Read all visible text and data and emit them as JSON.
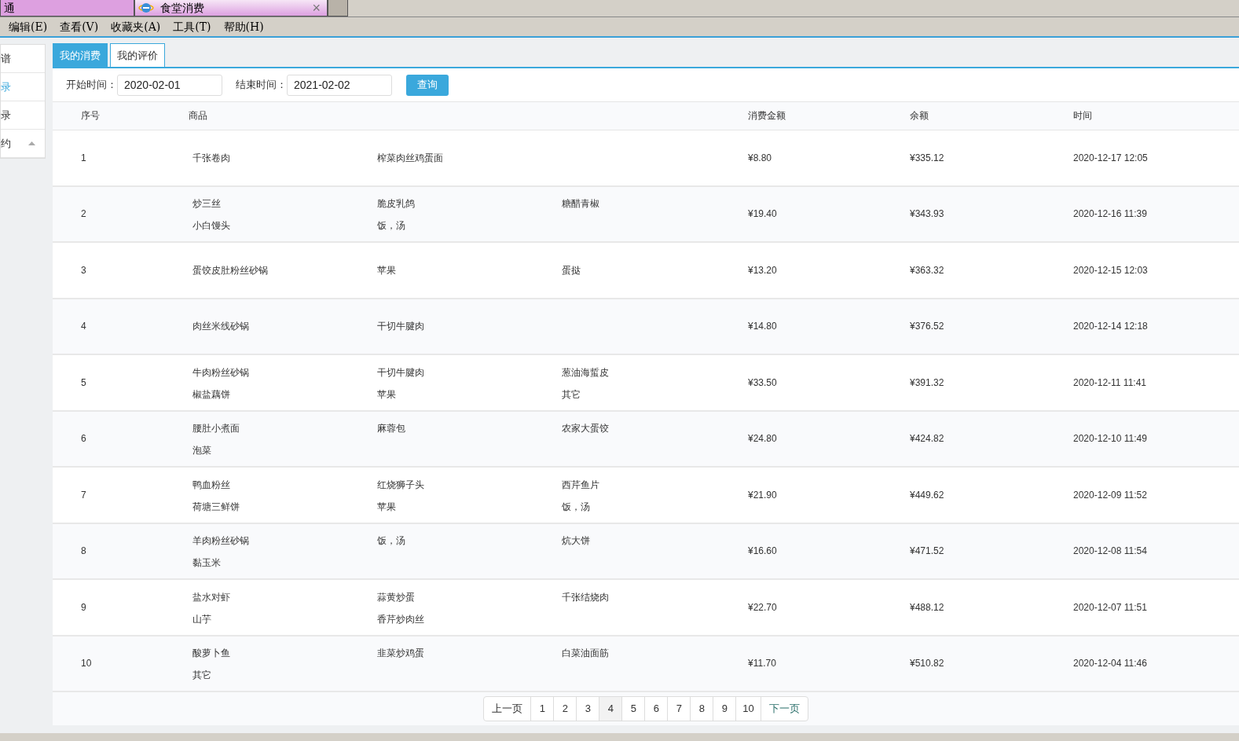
{
  "browser_tabs": [
    {
      "label": "通",
      "selected": false,
      "kind": "plain"
    },
    {
      "label": "食堂消费",
      "selected": true,
      "kind": "page"
    }
  ],
  "close_glyph": "×",
  "menu": [
    "编辑(E)",
    "查看(V)",
    "收藏夹(A)",
    "工具(T)",
    "帮助(H)"
  ],
  "sidebar": [
    {
      "label": "谱",
      "selected": false,
      "expandable": false
    },
    {
      "label": "录",
      "selected": true,
      "expandable": false
    },
    {
      "label": "录",
      "selected": false,
      "expandable": false
    },
    {
      "label": "约",
      "selected": false,
      "expandable": true
    }
  ],
  "tabs": [
    {
      "label": "我的消费",
      "selected": true
    },
    {
      "label": "我的评价",
      "selected": false
    }
  ],
  "filter": {
    "start_label": "开始时间：",
    "start_value": "2020-02-01",
    "end_label": "结束时间：",
    "end_value": "2021-02-02",
    "button": "查询"
  },
  "table": {
    "columns": [
      "序号",
      "商品",
      "消费金额",
      "余额",
      "时间"
    ],
    "rows": [
      {
        "no": "1",
        "goods": [
          [
            "千张卷肉"
          ],
          [
            "榨菜肉丝鸡蛋面"
          ]
        ],
        "amount": "¥8.80",
        "balance": "¥335.12",
        "time": "2020-12-17 12:05"
      },
      {
        "no": "2",
        "goods": [
          [
            "炒三丝",
            "小白馒头"
          ],
          [
            "脆皮乳鸽",
            "饭，汤"
          ],
          [
            "糖醋青椒"
          ]
        ],
        "amount": "¥19.40",
        "balance": "¥343.93",
        "time": "2020-12-16 11:39"
      },
      {
        "no": "3",
        "goods": [
          [
            "蛋饺皮肚粉丝砂锅"
          ],
          [
            "苹果"
          ],
          [
            "蛋挞"
          ]
        ],
        "amount": "¥13.20",
        "balance": "¥363.32",
        "time": "2020-12-15 12:03"
      },
      {
        "no": "4",
        "goods": [
          [
            "肉丝米线砂锅"
          ],
          [
            "干切牛腱肉"
          ]
        ],
        "amount": "¥14.80",
        "balance": "¥376.52",
        "time": "2020-12-14 12:18"
      },
      {
        "no": "5",
        "goods": [
          [
            "牛肉粉丝砂锅",
            "椒盐藕饼"
          ],
          [
            "干切牛腱肉",
            "苹果"
          ],
          [
            "葱油海蜇皮",
            "其它"
          ]
        ],
        "amount": "¥33.50",
        "balance": "¥391.32",
        "time": "2020-12-11 11:41"
      },
      {
        "no": "6",
        "goods": [
          [
            "腰肚小煮面",
            "泡菜"
          ],
          [
            "麻蓉包"
          ],
          [
            "农家大蛋饺"
          ]
        ],
        "amount": "¥24.80",
        "balance": "¥424.82",
        "time": "2020-12-10 11:49"
      },
      {
        "no": "7",
        "goods": [
          [
            "鸭血粉丝",
            "荷塘三鲜饼"
          ],
          [
            "红烧狮子头",
            "苹果"
          ],
          [
            "西芹鱼片",
            "饭，汤"
          ]
        ],
        "amount": "¥21.90",
        "balance": "¥449.62",
        "time": "2020-12-09 11:52"
      },
      {
        "no": "8",
        "goods": [
          [
            "羊肉粉丝砂锅",
            "黏玉米"
          ],
          [
            "饭，汤"
          ],
          [
            "炕大饼"
          ]
        ],
        "amount": "¥16.60",
        "balance": "¥471.52",
        "time": "2020-12-08 11:54"
      },
      {
        "no": "9",
        "goods": [
          [
            "盐水对虾",
            "山芋"
          ],
          [
            "蒜黄炒蛋",
            "香芹炒肉丝"
          ],
          [
            "千张结烧肉"
          ]
        ],
        "amount": "¥22.70",
        "balance": "¥488.12",
        "time": "2020-12-07 11:51"
      },
      {
        "no": "10",
        "goods": [
          [
            "酸萝卜鱼",
            "其它"
          ],
          [
            "韭菜炒鸡蛋"
          ],
          [
            "白菜油面筋"
          ]
        ],
        "amount": "¥11.70",
        "balance": "¥510.82",
        "time": "2020-12-04 11:46"
      }
    ]
  },
  "pagination": {
    "prev": "上一页",
    "pages": [
      {
        "label": "1",
        "selected": false
      },
      {
        "label": "2",
        "selected": false
      },
      {
        "label": "3",
        "selected": false
      },
      {
        "label": "4",
        "selected": true
      },
      {
        "label": "5",
        "selected": false
      },
      {
        "label": "6",
        "selected": false
      },
      {
        "label": "7",
        "selected": false
      },
      {
        "label": "8",
        "selected": false
      },
      {
        "label": "9",
        "selected": false
      },
      {
        "label": "10",
        "selected": false
      }
    ],
    "next": "下一页"
  }
}
